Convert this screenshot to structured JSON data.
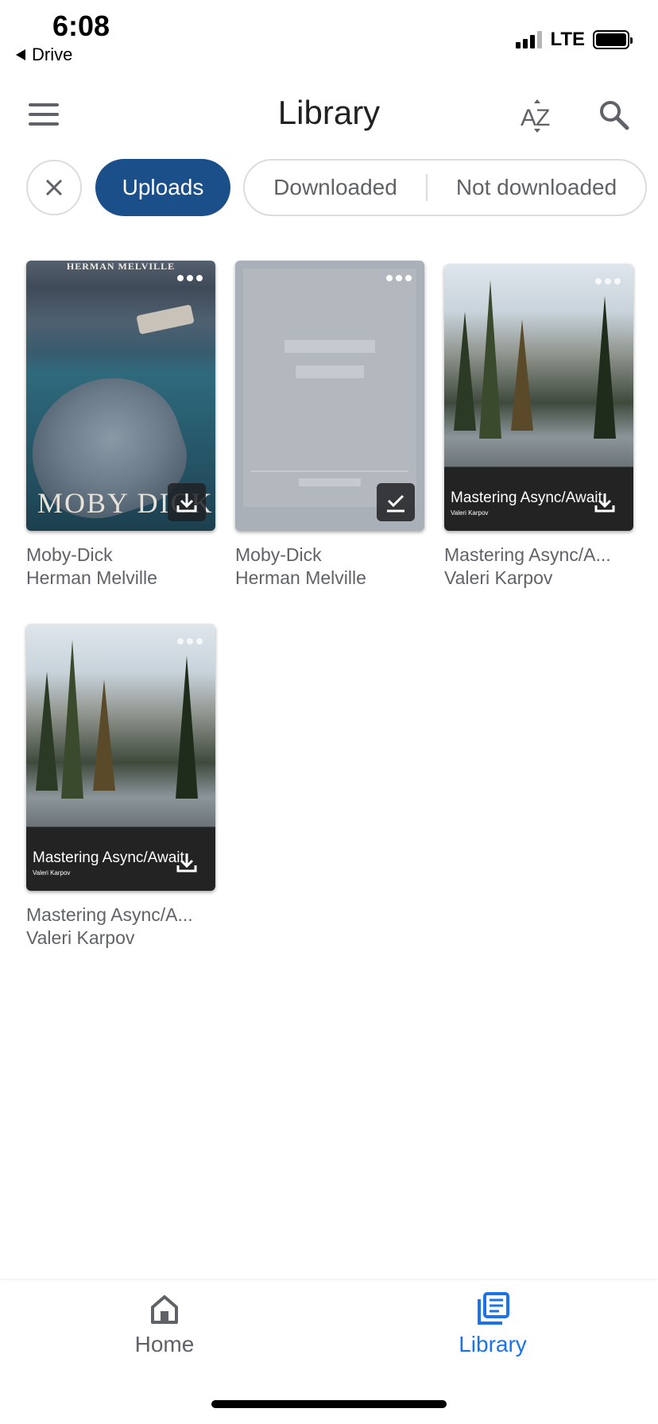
{
  "status_bar": {
    "time": "6:08",
    "back_label": "Drive",
    "network": "LTE"
  },
  "header": {
    "title": "Library",
    "menu_icon": "menu-icon",
    "sort_icon": "sort-az-icon",
    "search_icon": "search-icon"
  },
  "filters": {
    "clear_icon": "close-icon",
    "chips": [
      {
        "label": "Uploads",
        "selected": true
      },
      {
        "label": "Downloaded",
        "selected": false
      },
      {
        "label": "Not downloaded",
        "selected": false
      }
    ]
  },
  "books": [
    {
      "title": "Moby-Dick",
      "author": "Herman Melville",
      "cover": {
        "author_text": "HERMAN MELVILLE",
        "title_text": "MOBY DICK"
      },
      "action_icon": "download-icon"
    },
    {
      "title": "Moby-Dick",
      "author": "Herman Melville",
      "cover": {},
      "action_icon": "downloaded-check-icon"
    },
    {
      "title": "Mastering Async/A...",
      "author": "Valeri Karpov",
      "cover": {
        "title_text": "Mastering Async/Await",
        "author_text": "Valeri Karpov"
      },
      "action_icon": "download-icon"
    },
    {
      "title": "Mastering Async/A...",
      "author": "Valeri Karpov",
      "cover": {
        "title_text": "Mastering Async/Await",
        "author_text": "Valeri Karpov"
      },
      "action_icon": "download-icon"
    }
  ],
  "bottom_nav": {
    "items": [
      {
        "label": "Home",
        "icon": "home-icon",
        "active": false
      },
      {
        "label": "Library",
        "icon": "library-icon",
        "active": true
      }
    ]
  },
  "colors": {
    "accent": "#1a73e8",
    "chip_selected": "#1a4f8a",
    "muted_text": "#5f6368"
  }
}
